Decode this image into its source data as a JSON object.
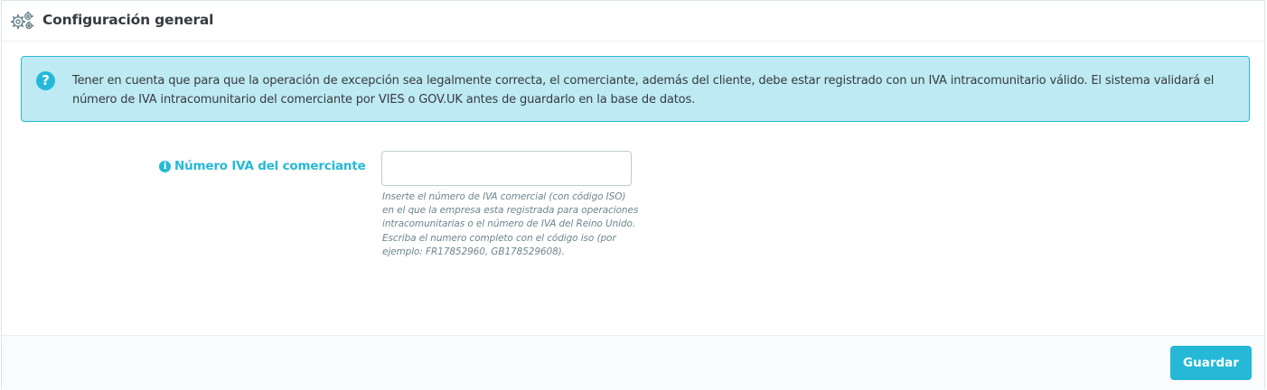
{
  "header": {
    "title": "Configuración general",
    "icon": "gears-icon"
  },
  "alert": {
    "icon": "question-circle-icon",
    "icon_glyph": "?",
    "text": "Tener en cuenta que para que la operación de excepción sea legalmente correcta, el comerciante, además del cliente, debe estar registrado con un IVA intracomunitario válido. El sistema validará el número de IVA intracomunitario del comerciante por VIES o GOV.UK antes de guardarlo en la base de datos."
  },
  "form": {
    "merchant_vat": {
      "label": "Número IVA del comerciante",
      "info_icon": "info-circle-icon",
      "info_glyph": "i",
      "value": "",
      "placeholder": "",
      "help": "Inserte el número de IVA comercial (con código ISO) en el que la empresa esta registrada para operaciones intracomunitarias o el número de IVA del Reino Unido. Escriba el numero completo con el código iso (por ejemplo: FR17852960, GB178529608)."
    }
  },
  "footer": {
    "save_label": "Guardar"
  },
  "colors": {
    "accent": "#25b9d7",
    "alert_background": "#beeaf3",
    "text": "#363a41",
    "help_text": "#6c868e"
  }
}
